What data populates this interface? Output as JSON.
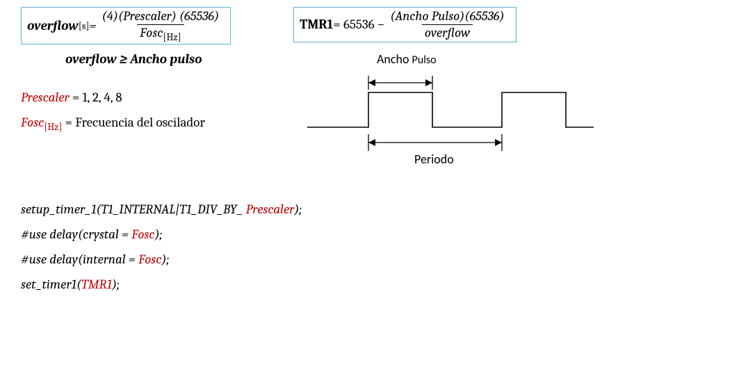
{
  "formulas": {
    "overflow": {
      "lhs_name": "overflow",
      "lhs_sub": "[s]",
      "equals": " = ",
      "numerator": "(4)(Prescaler) (65536)",
      "denom_name": "Fosc",
      "denom_sub": "[Hz]"
    },
    "tmr1": {
      "lhs_name": "TMR1",
      "equals": " = 65536 − ",
      "numerator": "(Ancho Pulso)(65536)",
      "denominator": "overflow"
    },
    "constraint": "overflow ≥ Ancho pulso"
  },
  "defs": {
    "prescaler_name": "Prescaler",
    "prescaler_eq": " = 1, 2, 4, 8",
    "fosc_name": "Fosc",
    "fosc_sub": "[Hz]",
    "fosc_eq": " = Frecuencia del oscilador"
  },
  "diagram": {
    "ancho_pulso_label": "Ancho",
    "pulso_label": "Pulso",
    "periodo_label": "Periodo"
  },
  "code": {
    "line1_pre": "setup_timer_1(T1_INTERNAL|T1_DIV_BY_",
    "line1_var": " Prescaler",
    "line1_post": ");",
    "line2_pre": "#use delay(crystal = ",
    "line2_var": "Fosc",
    "line2_post": ");",
    "line3_pre": "#use delay(internal = ",
    "line3_var": "Fosc",
    "line3_post": ");",
    "line4_pre": "set_timer1(",
    "line4_var": "TMR1",
    "line4_post": ");"
  }
}
